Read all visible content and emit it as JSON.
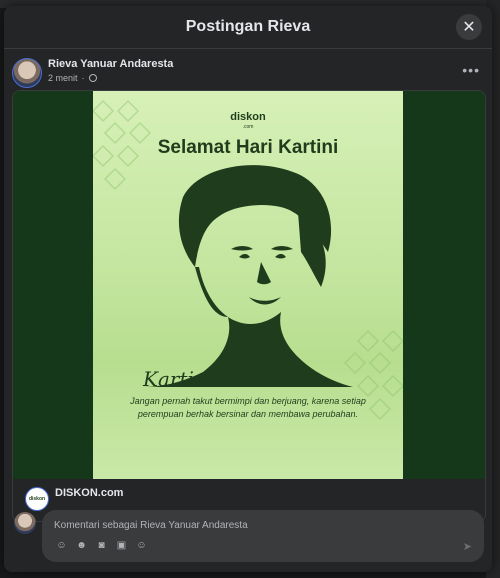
{
  "modal": {
    "title": "Postingan Rieva",
    "close_icon": "close-icon"
  },
  "post": {
    "author": "Rieva Yanuar Andaresta",
    "time": "2 menit",
    "privacy_icon": "globe-icon",
    "more_icon": "more-options-icon"
  },
  "shared": {
    "poster": {
      "brand": "diskon",
      "brand_sub": ".com",
      "title": "Selamat Hari Kartini",
      "signature": "Kartini",
      "quote": "Jangan pernah takut bermimpi dan berjuang, karena setiap perempuan berhak bersinar dan membawa perubahan."
    },
    "page_name": "DISKON.com"
  },
  "comment": {
    "placeholder": "Komentari sebagai Rieva Yanuar Andaresta",
    "tools": [
      "sticker-icon",
      "emoji-icon",
      "camera-icon",
      "gif-icon",
      "avatar-sticker-icon"
    ],
    "send_icon": "send-icon"
  },
  "colors": {
    "modal_bg": "#242526",
    "poster_green": "#15381a",
    "poster_light": "#c4e6a0"
  }
}
